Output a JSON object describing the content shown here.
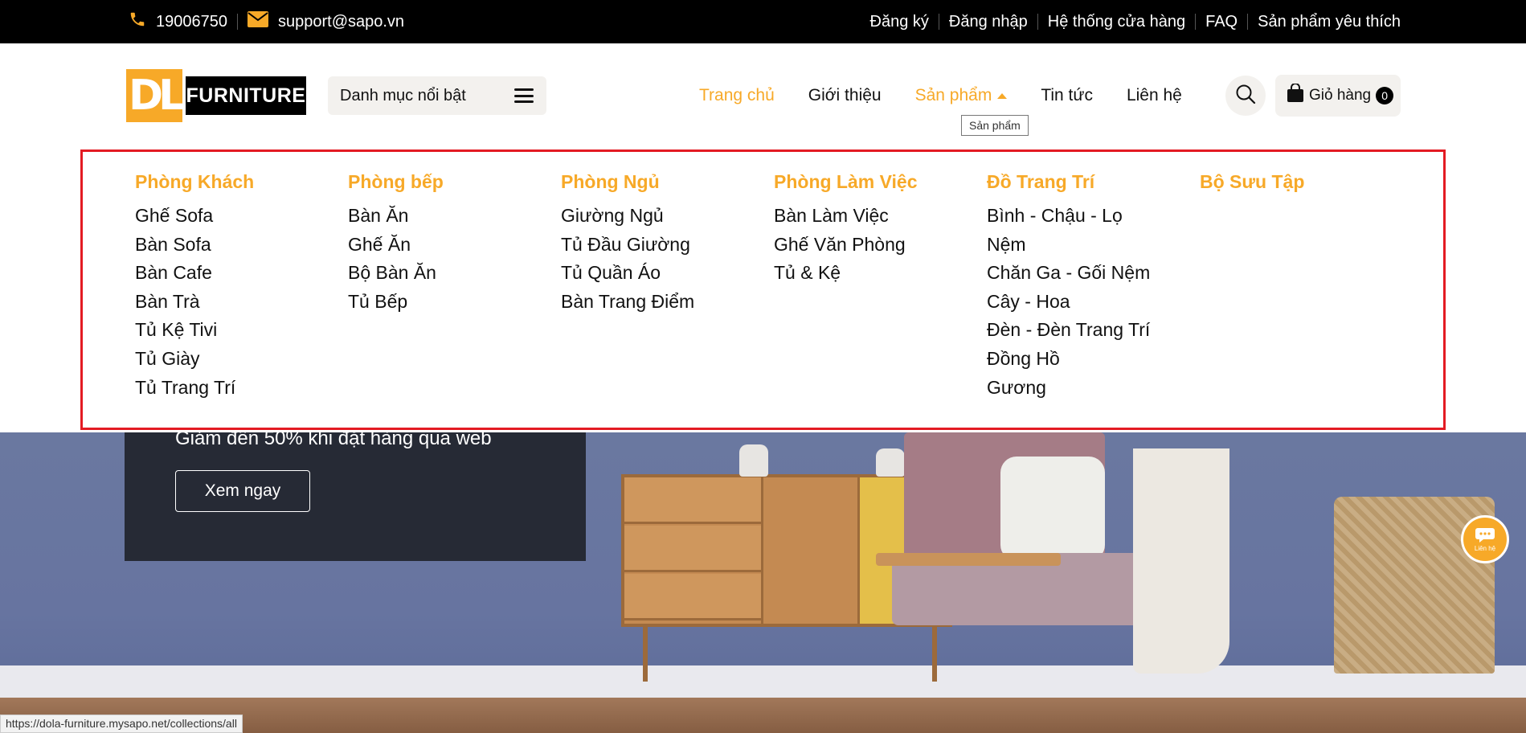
{
  "topbar": {
    "phone": "19006750",
    "email": "support@sapo.vn",
    "links": [
      "Đăng ký",
      "Đăng nhập",
      "Hệ thống cửa hàng",
      "FAQ",
      "Sản phẩm yêu thích"
    ]
  },
  "header": {
    "logo_mark": "DL",
    "logo_word": "FURNITURE",
    "category_button": "Danh mục nổi bật",
    "nav": [
      "Trang chủ",
      "Giới thiệu",
      "Sản phẩm",
      "Tin tức",
      "Liên hệ"
    ],
    "tooltip": "Sản phẩm",
    "cart_label": "Giỏ hàng",
    "cart_count": "0"
  },
  "megamenu": {
    "columns": [
      {
        "title": "Phòng Khách",
        "items": [
          "Ghế Sofa",
          "Bàn Sofa",
          "Bàn Cafe",
          "Bàn Trà",
          "Tủ Kệ Tivi",
          "Tủ Giày",
          "Tủ Trang Trí"
        ]
      },
      {
        "title": "Phòng bếp",
        "items": [
          "Bàn Ăn",
          "Ghế Ăn",
          "Bộ Bàn Ăn",
          "Tủ Bếp"
        ]
      },
      {
        "title": "Phòng Ngủ",
        "items": [
          "Giường Ngủ",
          "Tủ Đầu Giường",
          "Tủ Quần Áo",
          "Bàn Trang Điểm"
        ]
      },
      {
        "title": "Phòng Làm Việc",
        "items": [
          "Bàn Làm Việc",
          "Ghế Văn Phòng",
          "Tủ & Kệ"
        ]
      },
      {
        "title": "Đồ Trang Trí",
        "items": [
          "Bình - Chậu - Lọ",
          "Nệm",
          "Chăn Ga - Gối Nệm",
          "Cây - Hoa",
          "Đèn - Đèn Trang Trí",
          "Đồng Hồ",
          "Gương"
        ]
      },
      {
        "title": "Bộ Sưu Tập",
        "items": []
      }
    ]
  },
  "hero": {
    "promo_text": "Giảm đến 50% khi đặt hàng qua web",
    "button": "Xem ngay"
  },
  "chat_label": "Liên hệ",
  "status_url": "https://dola-furniture.mysapo.net/collections/all",
  "colors": {
    "accent": "#f7a928",
    "highlight_border": "#e31b23",
    "topbar_bg": "#000000"
  }
}
